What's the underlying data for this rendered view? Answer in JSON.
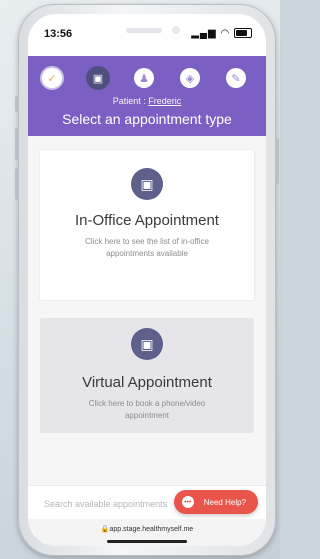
{
  "status": {
    "time": "13:56",
    "icons": [
      "signal-icon",
      "wifi-icon",
      "battery-icon"
    ]
  },
  "header": {
    "steps": [
      {
        "icon": "check-icon",
        "glyph": "✓",
        "state": "done"
      },
      {
        "icon": "briefcase-icon",
        "glyph": "▣",
        "state": "active"
      },
      {
        "icon": "person-icon",
        "glyph": "♟",
        "state": "pending"
      },
      {
        "icon": "shield-icon",
        "glyph": "◈",
        "state": "pending"
      },
      {
        "icon": "edit-icon",
        "glyph": "✎",
        "state": "pending"
      }
    ],
    "patient_label": "Patient : ",
    "patient_name": "Frederic",
    "title": "Select an appointment type"
  },
  "cards": {
    "office": {
      "icon": "briefcase-icon",
      "title": "In-Office Appointment",
      "description": "Click here to see the list of in-office appointments available"
    },
    "virtual": {
      "icon": "briefcase-icon",
      "title": "Virtual Appointment",
      "description": "Click here to book a phone/video appointment"
    }
  },
  "search": {
    "placeholder": "Search available appointments"
  },
  "help": {
    "label": "Need Help?",
    "icon": "chat-icon"
  },
  "browser": {
    "url": "app.stage.healthmyself.me"
  },
  "colors": {
    "header": "#7b5fc2",
    "icon_bg": "#5e5f8a",
    "help": "#e9554b"
  }
}
